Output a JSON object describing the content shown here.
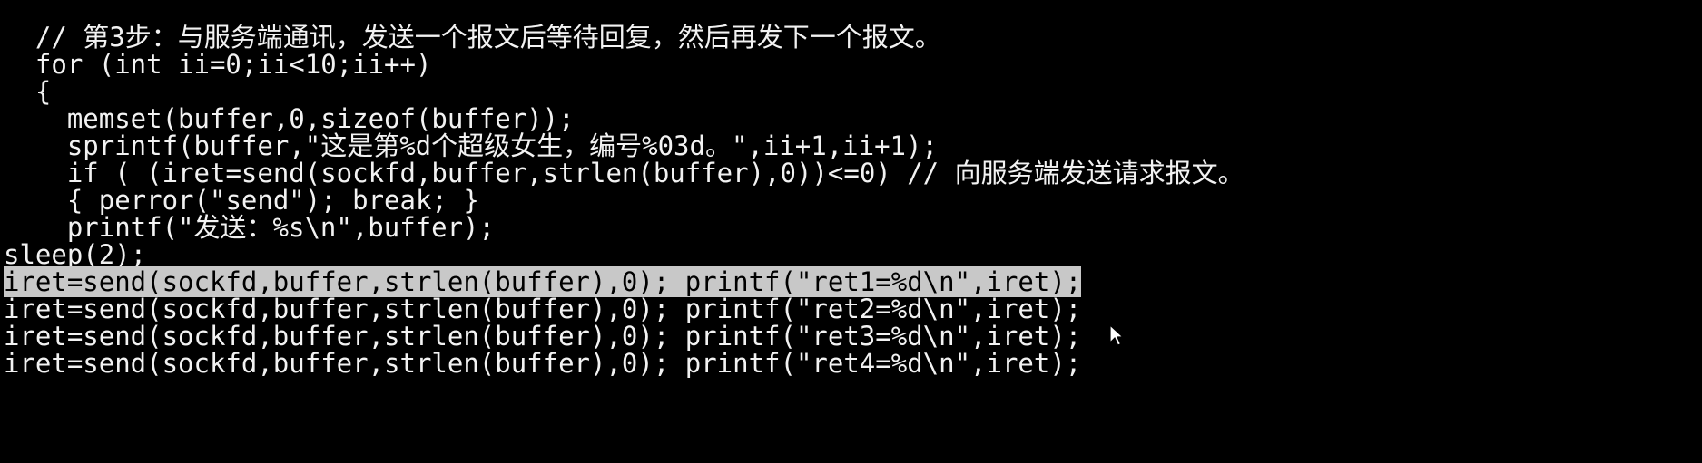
{
  "terminal": {
    "lines": [
      {
        "indent": "  ",
        "text": "// 第3步：与服务端通讯，发送一个报文后等待回复，然后再发下一个报文。"
      },
      {
        "indent": "  ",
        "text": "for (int ii=0;ii<10;ii++)"
      },
      {
        "indent": "  ",
        "text": "{"
      },
      {
        "indent": "    ",
        "text": "memset(buffer,0,sizeof(buffer));"
      },
      {
        "indent": "    ",
        "text": "sprintf(buffer,\"这是第%d个超级女生，编号%03d。\",ii+1,ii+1);"
      },
      {
        "indent": "    ",
        "text": "if ( (iret=send(sockfd,buffer,strlen(buffer),0))<=0) // 向服务端发送请求报文。"
      },
      {
        "indent": "    ",
        "text": "{ perror(\"send\"); break; }"
      },
      {
        "indent": "    ",
        "text": "printf(\"发送：%s\\n\",buffer);"
      },
      {
        "indent": "",
        "text": "sleep(2);"
      },
      {
        "indent": "",
        "text": "iret=send(sockfd,buffer,strlen(buffer),0); printf(\"ret1=%d\\n\",iret);"
      },
      {
        "indent": "",
        "text": "iret=send(sockfd,buffer,strlen(buffer),0); printf(\"ret2=%d\\n\",iret);"
      },
      {
        "indent": "",
        "text": "iret=send(sockfd,buffer,strlen(buffer),0); printf(\"ret3=%d\\n\",iret);"
      },
      {
        "indent": "",
        "text": "iret=send(sockfd,buffer,strlen(buffer),0); printf(\"ret4=%d\\n\",iret);"
      }
    ],
    "selected_line_index": 9,
    "cursor_icon": "mouse-pointer-icon"
  },
  "colors": {
    "background": "#000000",
    "text": "#f2f2f2",
    "selection": "#c8c8c8"
  }
}
